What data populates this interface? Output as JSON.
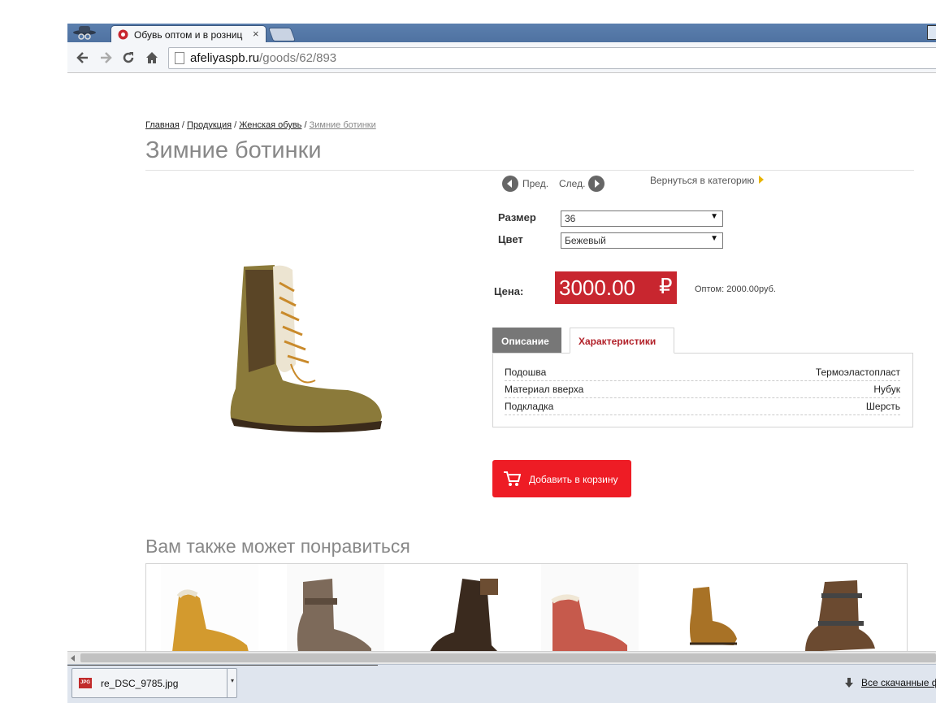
{
  "browser": {
    "tab_title": "Обувь оптом и в розниц",
    "tab_close": "×",
    "url_domain": "afeliyaspb.ru",
    "url_path": "/goods/62/893"
  },
  "breadcrumb": {
    "home": "Главная",
    "sep1": " / ",
    "products": "Продукция",
    "sep2": " / ",
    "womens": "Женская обувь",
    "sep3": " / ",
    "current": "Зимние ботинки"
  },
  "product": {
    "title": "Зимние ботинки",
    "prev_label": "Пред.",
    "next_label": "След.",
    "back_to_category": "Вернуться в категорию",
    "size_label": "Размер",
    "size_value": "36",
    "color_label": "Цвет",
    "color_value": "Бежевый",
    "price_label": "Цена:",
    "price": "3000.00",
    "currency": "₽",
    "wholesale": "Оптом: 2000.00руб.",
    "tab_description": "Описание",
    "tab_characteristics": "Характеристики",
    "specs": [
      {
        "key": "Подошва",
        "value": "Термоэластопласт"
      },
      {
        "key": "Материал вверха",
        "value": "Нубук"
      },
      {
        "key": "Подкладка",
        "value": "Шерсть"
      }
    ],
    "add_to_cart": "Добавить в корзину",
    "price_color": "#c8262f",
    "cart_color": "#ee1c25"
  },
  "related": {
    "title": "Вам также может понравиться"
  },
  "downloads": {
    "file_type": "JPG",
    "file_name": "re_DSC_9785.jpg",
    "menu_caret": "▾",
    "all_downloads": "Все скачанные ф"
  },
  "icons": [
    "incognito-icon",
    "favicon-icon",
    "back-arrow-icon",
    "forward-arrow-icon",
    "reload-icon",
    "home-icon",
    "page-icon",
    "prev-arrow-icon",
    "next-arrow-icon",
    "chevron-right-icon",
    "cart-icon",
    "jpg-file-icon",
    "download-arrow-icon"
  ]
}
